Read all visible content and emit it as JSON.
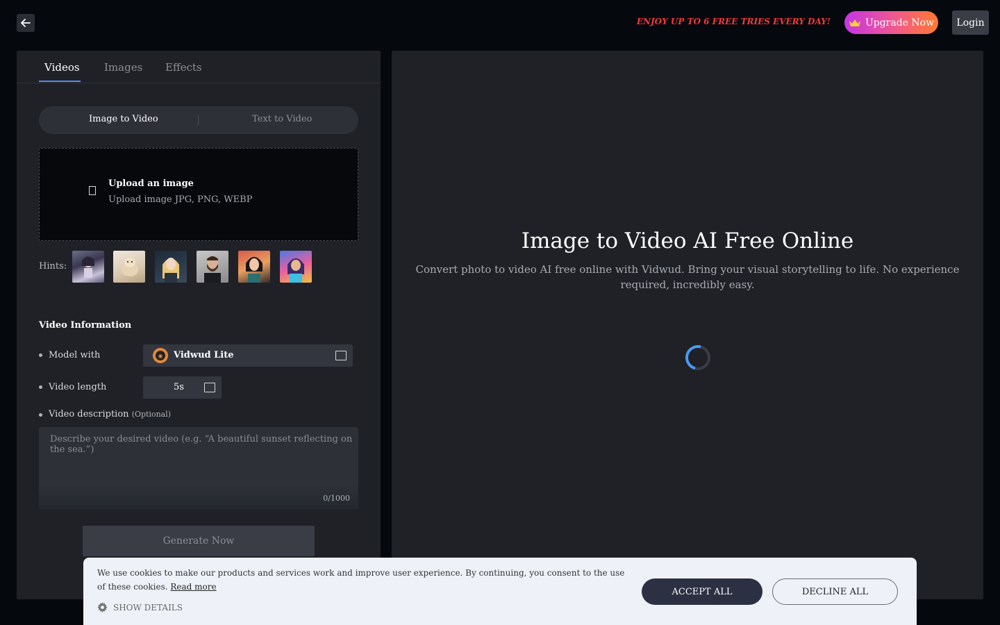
{
  "topbar": {
    "promo": "ENJOY UP TO 6 FREE TRIES EVERY DAY!",
    "upgrade_label": "Upgrade Now",
    "login_label": "Login"
  },
  "tabs": [
    {
      "label": "Videos",
      "active": true
    },
    {
      "label": "Images",
      "active": false
    },
    {
      "label": "Effects",
      "active": false
    }
  ],
  "mode_toggle": {
    "image_to_video": "Image to Video",
    "text_to_video": "Text to Video",
    "selected": "Image to Video"
  },
  "upload": {
    "title": "Upload an image",
    "subtitle": "Upload image JPG, PNG, WEBP"
  },
  "hints": {
    "label": "Hints:"
  },
  "video_info": {
    "title": "Video Information",
    "model_label": "Model with",
    "model_value": "Vidwud Lite",
    "length_label": "Video length",
    "length_value": "5s",
    "desc_label": "Video description",
    "desc_optional": "(Optional)",
    "desc_placeholder": "Describe your desired video (e.g. “A beautiful sunset reflecting on the sea.”)",
    "desc_count": "0/1000"
  },
  "generate_label": "Generate Now",
  "main": {
    "title": "Image to Video AI Free Online",
    "subtitle": "Convert photo to video AI free online with Vidwud. Bring your visual storytelling to life. No experience required, incredibly easy."
  },
  "cookie": {
    "text": "We use cookies to make our products and services work and improve user experience. By continuing, you consent to the use of these cookies.",
    "read_more": "Read more",
    "show_details": "SHOW DETAILS",
    "accept": "ACCEPT ALL",
    "decline": "DECLINE ALL"
  },
  "colors": {
    "accent": "#5b8def",
    "promo": "#f03a3a",
    "panel": "#1f2127",
    "cookie_accept": "#2b3043"
  }
}
